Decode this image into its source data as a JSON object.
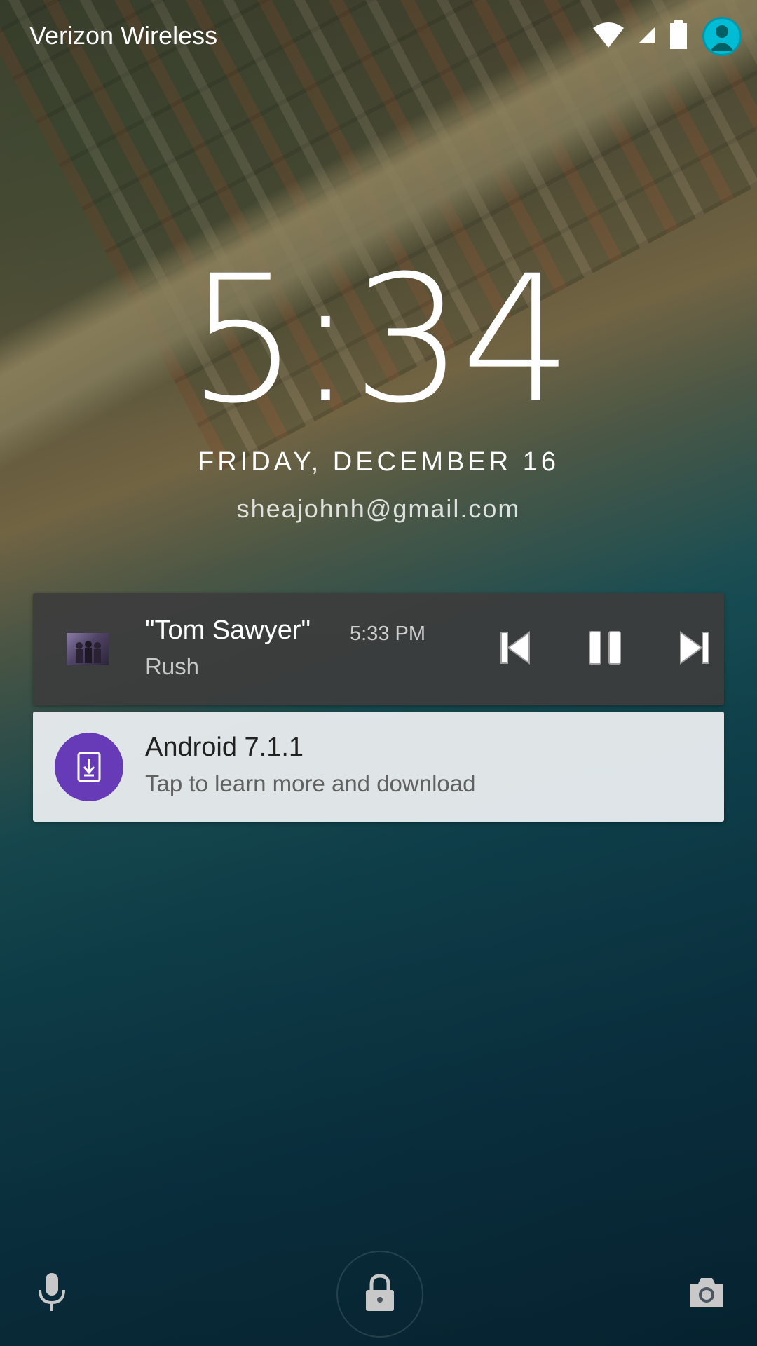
{
  "status_bar": {
    "carrier": "Verizon Wireless",
    "icons": [
      "wifi-icon",
      "cell-signal-icon",
      "battery-icon",
      "user-avatar-icon"
    ],
    "avatar_color": "#00bcd4"
  },
  "lockscreen": {
    "time": "5:34",
    "date": "FRIDAY, DECEMBER 16",
    "owner_info": "sheajohnh@gmail.com"
  },
  "media_notification": {
    "title": "\"Tom Sawyer\"",
    "artist": "Rush",
    "time": "5:33 PM",
    "controls": [
      "previous-icon",
      "pause-icon",
      "next-icon"
    ],
    "background": "#3c3c3c"
  },
  "update_notification": {
    "title": "Android 7.1.1",
    "text": "Tap to learn more and download",
    "icon": "system-update-icon",
    "icon_color": "#673ab7"
  },
  "bottom_affordances": [
    "microphone-icon",
    "lock-icon",
    "camera-icon"
  ]
}
